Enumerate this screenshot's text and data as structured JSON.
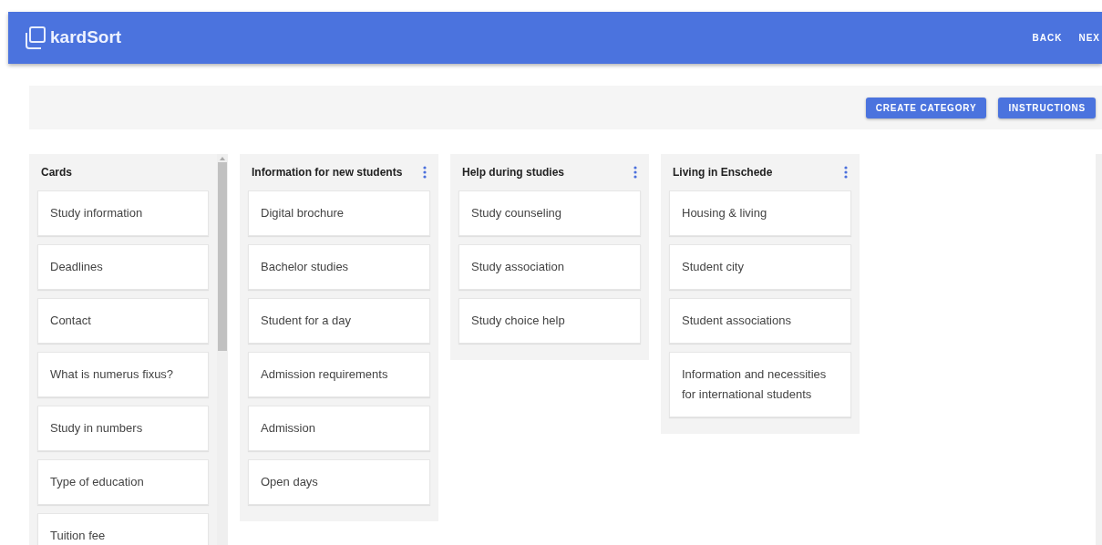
{
  "app_bar": {
    "brand": "kardSort",
    "nav": [
      "BACK",
      "NEX"
    ]
  },
  "toolbar": {
    "buttons": [
      "CREATE CATEGORY",
      "INSTRUCTIONS"
    ]
  },
  "cards_column": {
    "title": "Cards",
    "cards": [
      "Study information",
      "Deadlines",
      "Contact",
      "What is numerus fixus?",
      "Study in numbers",
      "Type of education",
      "Tuition fee"
    ]
  },
  "categories": [
    {
      "title": "Information for new students",
      "cards": [
        "Digital brochure",
        "Bachelor studies",
        "Student for a day",
        "Admission requirements",
        "Admission",
        "Open days"
      ]
    },
    {
      "title": "Help during studies",
      "cards": [
        "Study counseling",
        "Study association",
        "Study choice help"
      ]
    },
    {
      "title": "Living in Enschede",
      "cards": [
        "Housing & living",
        "Student city",
        "Student associations",
        "Information and necessities for international students"
      ]
    }
  ]
}
